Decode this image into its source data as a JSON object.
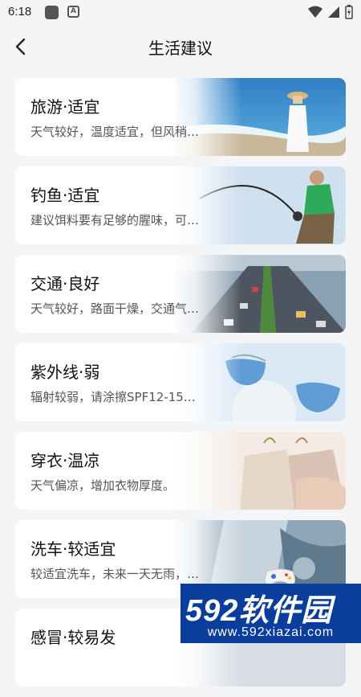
{
  "status_bar": {
    "time": "6:18",
    "icon_b_letter": "A"
  },
  "header": {
    "title": "生活建议"
  },
  "cards": [
    {
      "title": "旅游·适宜",
      "desc": "天气较好，温度适宜，但风稍…",
      "image_icon": "beach-photo"
    },
    {
      "title": "钓鱼·适宜",
      "desc": "建议饵料要有足够的腥味，可…",
      "image_icon": "fishing-photo"
    },
    {
      "title": "交通·良好",
      "desc": "天气较好，路面干燥，交通气…",
      "image_icon": "traffic-photo"
    },
    {
      "title": "紫外线·弱",
      "desc": "辐射较弱，请涂擦SPF12-15…",
      "image_icon": "sunglasses-photo"
    },
    {
      "title": "穿衣·温凉",
      "desc": "天气偏凉，增加衣物厚度。",
      "image_icon": "clothes-photo"
    },
    {
      "title": "洗车·较适宜",
      "desc": "较适宜洗车，未来一天无雨，…",
      "image_icon": "carwash-photo"
    },
    {
      "title": "感冒·较易发",
      "desc": "",
      "image_icon": "cold-photo"
    }
  ],
  "watermark": {
    "main": "592软件园",
    "sub": "www.592xiazai.com"
  },
  "colors": {
    "background": "#f4f5f7",
    "card": "#ffffff",
    "watermark": "#0b3d9c"
  }
}
